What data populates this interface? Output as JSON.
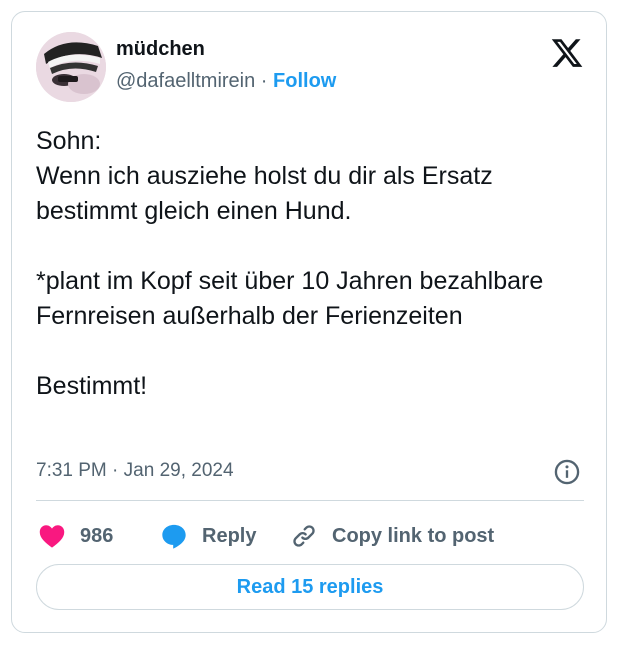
{
  "author": {
    "display_name": "müdchen",
    "handle": "@dafaelltmirein",
    "separator": " · ",
    "follow_label": "Follow"
  },
  "tweet": {
    "text": "Sohn:\nWenn ich ausziehe holst du dir als Ersatz bestimmt gleich einen Hund.\n\n*plant im Kopf seit über 10 Jahren bezahlbare Fernreisen außerhalb der Ferienzeiten\n\nBestimmt!",
    "time": "7:31 PM",
    "meta_separator": " · ",
    "date": "Jan 29, 2024"
  },
  "actions": {
    "like_count": "986",
    "reply_label": "Reply",
    "copy_label": "Copy link to post"
  },
  "read_replies_label": "Read 15 replies",
  "icons": {
    "brand": "x-logo-icon",
    "info": "info-icon",
    "like": "heart-icon",
    "reply": "speech-bubble-icon",
    "copy": "link-icon"
  },
  "colors": {
    "accent": "#1d9bf0",
    "like": "#f91880",
    "text": "#0f1419",
    "muted": "#536471",
    "border": "#cfd9de"
  }
}
